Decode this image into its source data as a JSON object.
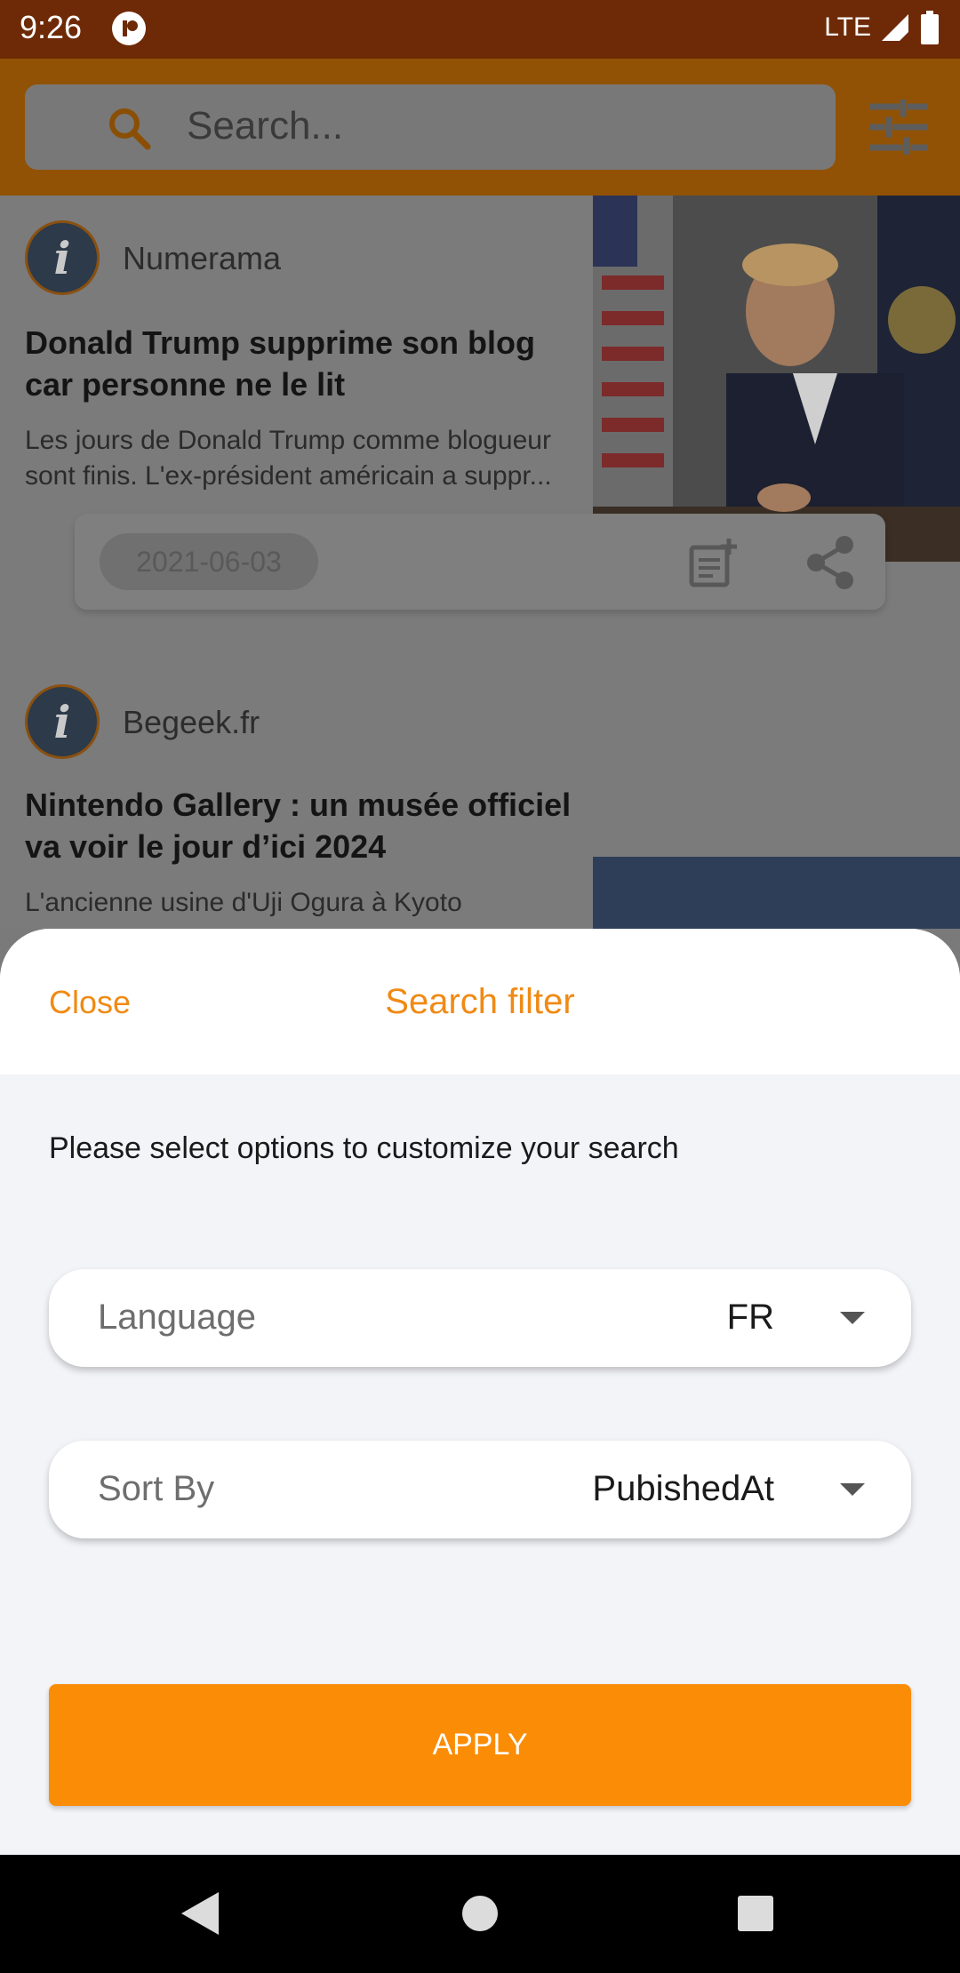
{
  "status_bar": {
    "time": "9:26",
    "network": "LTE"
  },
  "search": {
    "placeholder": "Search..."
  },
  "feed": [
    {
      "source": "Numerama",
      "headline": "Donald Trump supprime son blog car personne ne le lit",
      "summary": "Les jours de Donald Trump comme blogueur sont finis. L'ex-président américain a suppr...",
      "date": "2021-06-03"
    },
    {
      "source": "Begeek.fr",
      "headline": "Nintendo Gallery : un musée officiel va voir le jour d’ici 2024",
      "summary": "L'ancienne usine d'Uji Ogura à Kyoto"
    }
  ],
  "sheet": {
    "close_label": "Close",
    "title": "Search filter",
    "instructions": "Please select options to customize your search",
    "language": {
      "label": "Language",
      "value": "FR"
    },
    "sort_by": {
      "label": "Sort By",
      "value": "PubishedAt"
    },
    "apply_label": "APPLY"
  },
  "colors": {
    "accent": "#fb8c06",
    "title_orange": "#f08a14",
    "status_bar": "#6e2a06"
  }
}
